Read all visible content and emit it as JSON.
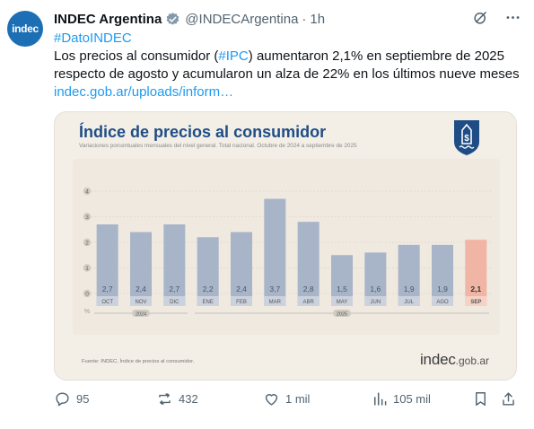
{
  "account": {
    "avatar_text": "indec",
    "name": "INDEC Argentina",
    "handle": "@INDECArgentina",
    "separator": "·",
    "time": "1h",
    "brand_color": "#1d6fb5",
    "verified_color": "#829aab"
  },
  "post": {
    "hashtag": "#DatoINDEC",
    "body_before": "Los precios al consumidor (",
    "body_tag": "#IPC",
    "body_after": ") aumentaron 2,1% en septiembre de 2025 respecto de agosto y acumularon un alza de 22% en los últimos nueve meses ",
    "link": "indec.gob.ar/uploads/inform…"
  },
  "card": {
    "title": "Índice de precios al consumidor",
    "subtitle": "Variaciones porcentuales mensuales del nivel general. Total nacional. Octubre de 2024 a septiembre de 2025",
    "source": "Fuente: INDEC, Índice de precios al consumidor.",
    "brand_main": "indec",
    "brand_suffix": ".gob.ar"
  },
  "chart_data": {
    "type": "bar",
    "ylabel": "%",
    "ylim": [
      0,
      4
    ],
    "yticks": [
      "0",
      "1",
      "2",
      "3",
      "4"
    ],
    "categories": [
      "OCT",
      "NOV",
      "DIC",
      "ENE",
      "FEB",
      "MAR",
      "ABR",
      "MAY",
      "JUN",
      "JUL",
      "AGO",
      "SEP"
    ],
    "values": [
      2.7,
      2.4,
      2.7,
      2.2,
      2.4,
      3.7,
      2.8,
      1.5,
      1.6,
      1.9,
      1.9,
      2.1
    ],
    "value_labels": [
      "2,7",
      "2,4",
      "2,7",
      "2,2",
      "2,4",
      "3,7",
      "2,8",
      "1,5",
      "1,6",
      "1,9",
      "1,9",
      "2,1"
    ],
    "year_groups": [
      {
        "label": "2024",
        "from": 0,
        "to": 2
      },
      {
        "label": "2025",
        "from": 3,
        "to": 11
      }
    ],
    "highlight_index": 11,
    "colors": {
      "bar": "#a8b4c8",
      "highlight": "#f0b5a4",
      "label_bg": "#cbd2de",
      "highlight_label_bg": "#f6d2c6",
      "value_text": "#4a5568"
    }
  },
  "actions": {
    "replies": "95",
    "reposts": "432",
    "likes": "1 mil",
    "views": "105 mil"
  }
}
